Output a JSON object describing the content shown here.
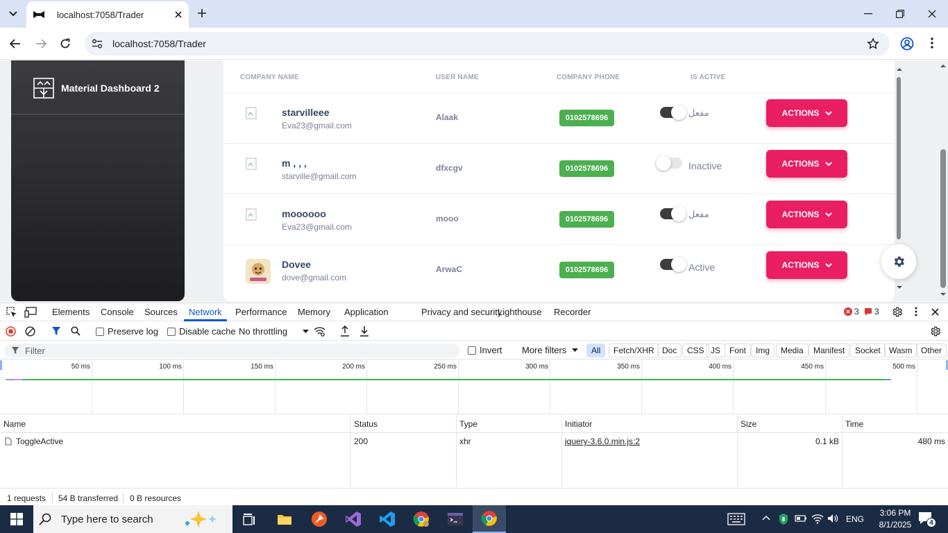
{
  "browser": {
    "tab_title": "localhost:7058/Trader",
    "url": "localhost:7058/Trader"
  },
  "sidebar": {
    "brand": "Material Dashboard 2"
  },
  "table": {
    "headers": {
      "company_name": "COMPANY NAME",
      "user_name": "USER NAME",
      "company_phone": "COMPANY PHONE",
      "is_active": "IS ACTIVE"
    },
    "rows": [
      {
        "company": "starvilleee",
        "email": "Eva23@gmail.com",
        "user": "Alaak",
        "phone": "0102578696",
        "active": true,
        "status": "مفعل",
        "action": "ACTIONS"
      },
      {
        "company": "m , , ,",
        "email": "starville@gmail.com",
        "user": "dfxcgv",
        "phone": "0102578696",
        "active": false,
        "status": "Inactive",
        "action": "ACTIONS"
      },
      {
        "company": "moooooo",
        "email": "Eva23@gmail.com",
        "user": "mooo",
        "phone": "0102578696",
        "active": true,
        "status": "مفعل",
        "action": "ACTIONS"
      },
      {
        "company": "Dovee",
        "email": "dove@gmail.com",
        "user": "ArwaC",
        "phone": "0102578696",
        "active": true,
        "status": "Active",
        "action": "ACTIONS"
      }
    ]
  },
  "devtools": {
    "tabs": [
      "Elements",
      "Console",
      "Sources",
      "Network",
      "Performance",
      "Memory",
      "Application",
      "Privacy and security",
      "Lighthouse",
      "Recorder"
    ],
    "active_tab": "Network",
    "errors": "3",
    "warnings": "3",
    "preserve_log": "Preserve log",
    "disable_cache": "Disable cache",
    "throttling": "No throttling",
    "filter_placeholder": "Filter",
    "invert": "Invert",
    "more_filters": "More filters",
    "filters": [
      "All",
      "Fetch/XHR",
      "Doc",
      "CSS",
      "JS",
      "Font",
      "Img",
      "Media",
      "Manifest",
      "Socket",
      "Wasm",
      "Other"
    ],
    "timeline_ticks": [
      "50 ms",
      "100 ms",
      "150 ms",
      "200 ms",
      "250 ms",
      "300 ms",
      "350 ms",
      "400 ms",
      "450 ms",
      "500 ms"
    ],
    "columns": {
      "name": "Name",
      "status": "Status",
      "type": "Type",
      "initiator": "Initiator",
      "size": "Size",
      "time": "Time"
    },
    "request": {
      "name": "ToggleActive",
      "status": "200",
      "type": "xhr",
      "initiator": "jquery-3.6.0.min.js:2",
      "size": "0.1 kB",
      "time": "480 ms"
    },
    "summary": {
      "requests": "1 requests",
      "transferred": "54 B transferred",
      "resources": "0 B resources"
    }
  },
  "taskbar": {
    "search_placeholder": "Type here to search",
    "language": "ENG",
    "time": "3:06 PM",
    "date": "8/1/2025",
    "notifications": "4"
  },
  "colors": {
    "accent_pink": "#e91e63",
    "phone_green": "#4caf50",
    "devtools_blue": "#0b57d0",
    "taskbar": "#1c2b44"
  }
}
